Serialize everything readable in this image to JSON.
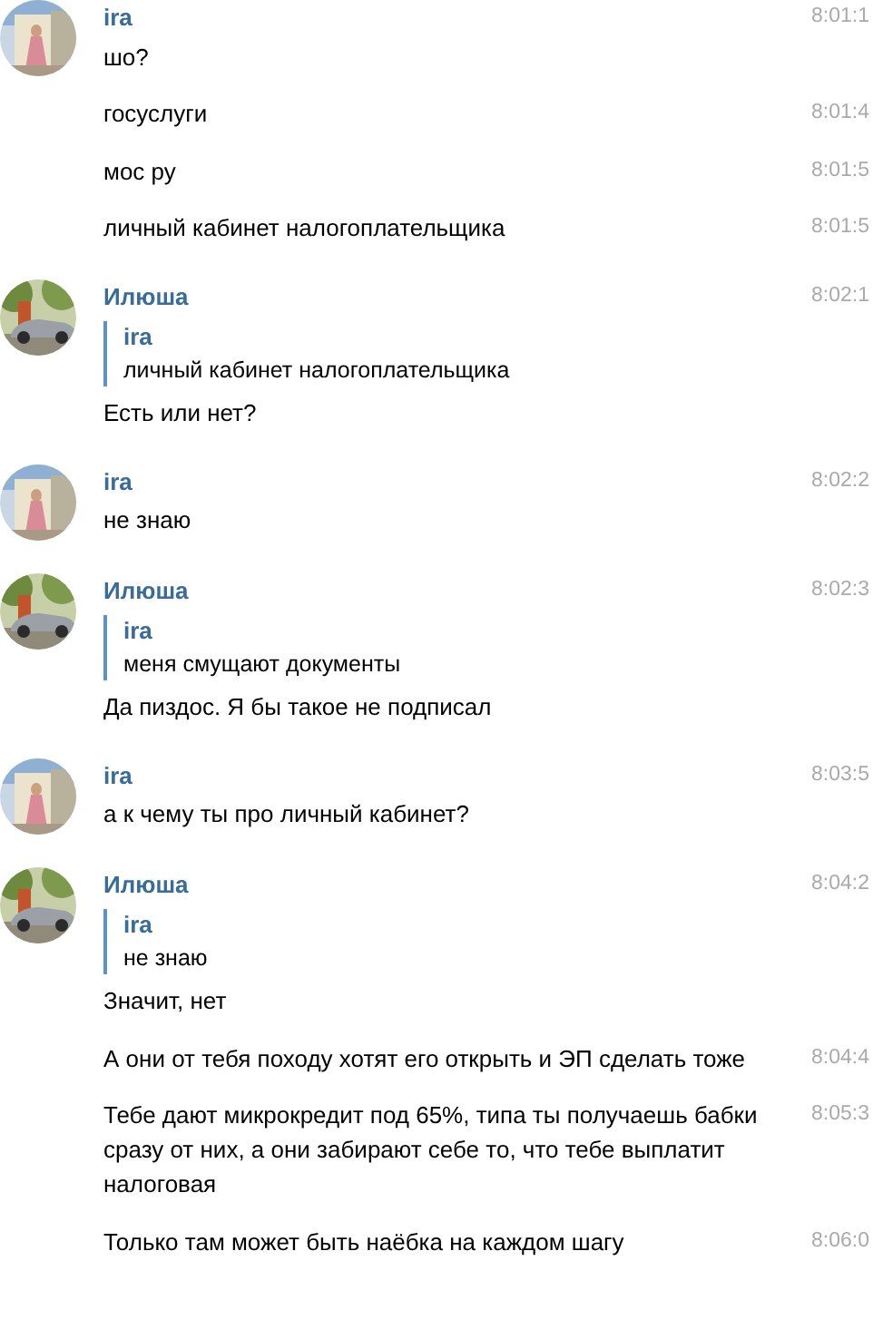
{
  "groups": [
    {
      "author": "ira",
      "time": "8:01:1",
      "messages": [
        {
          "text": "шо?"
        },
        {
          "text": "госуслуги",
          "time": "8:01:4"
        },
        {
          "text": "мос ру",
          "time": "8:01:5"
        },
        {
          "text": "личный кабинет налогоплательщика",
          "time": "8:01:5"
        }
      ]
    },
    {
      "author": "Илюша",
      "time": "8:02:1",
      "messages": [
        {
          "quote": {
            "author": "ira",
            "text": "личный кабинет налогоплательщика"
          },
          "text": "Есть или нет?"
        }
      ]
    },
    {
      "author": "ira",
      "time": "8:02:2",
      "messages": [
        {
          "text": "не знаю"
        }
      ]
    },
    {
      "author": "Илюша",
      "time": "8:02:3",
      "messages": [
        {
          "quote": {
            "author": "ira",
            "text": "меня смущают документы"
          },
          "text": "Да пиздос. Я бы такое не подписал"
        }
      ]
    },
    {
      "author": "ira",
      "time": "8:03:5",
      "messages": [
        {
          "text": "а к чему ты про личный кабинет?"
        }
      ]
    },
    {
      "author": "Илюша",
      "time": "8:04:2",
      "messages": [
        {
          "quote": {
            "author": "ira",
            "text": "не знаю"
          },
          "text": "Значит, нет"
        },
        {
          "text": "А они от тебя походу хотят его открыть и ЭП сделать тоже",
          "time": "8:04:4"
        },
        {
          "text": "Тебе дают микрокредит под 65%, типа ты получаешь бабки сразу от них, а они забирают себе то, что тебе выплатит налоговая",
          "time": "8:05:3"
        },
        {
          "text": "Только там может быть наёбка на каждом шагу",
          "time": "8:06:0"
        }
      ]
    }
  ]
}
